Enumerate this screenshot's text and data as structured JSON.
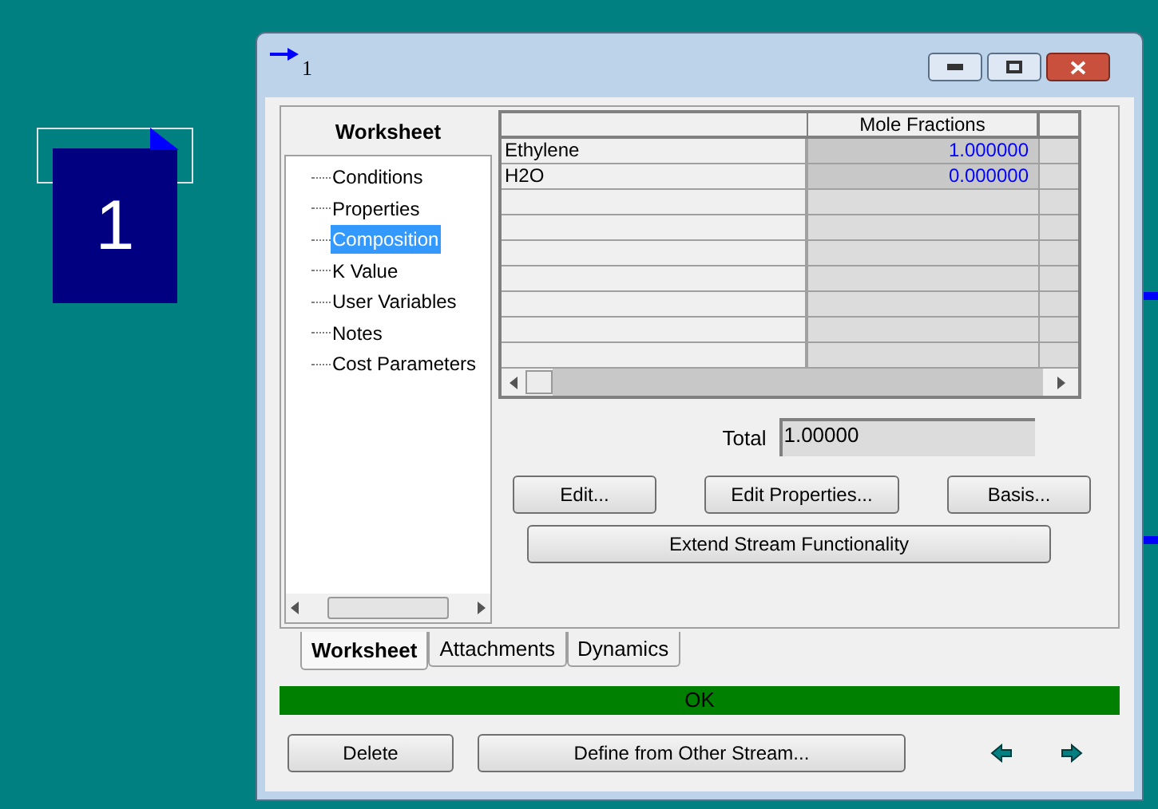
{
  "desktop": {
    "stream_label": "1"
  },
  "window": {
    "title": "1"
  },
  "tree": {
    "heading": "Worksheet",
    "items": [
      {
        "label": "Conditions",
        "selected": false
      },
      {
        "label": "Properties",
        "selected": false
      },
      {
        "label": "Composition",
        "selected": true
      },
      {
        "label": "K Value",
        "selected": false
      },
      {
        "label": "User Variables",
        "selected": false
      },
      {
        "label": "Notes",
        "selected": false
      },
      {
        "label": "Cost Parameters",
        "selected": false
      }
    ]
  },
  "grid": {
    "column_header": "Mole Fractions",
    "rows": [
      {
        "component": "Ethylene",
        "value": "1.000000"
      },
      {
        "component": "H2O",
        "value": "0.000000"
      }
    ]
  },
  "total": {
    "label": "Total",
    "value": "1.00000"
  },
  "buttons": [
    "Edit...",
    "Edit Properties...",
    "Basis..."
  ],
  "wide_button": "Extend Stream Functionality",
  "tabs": [
    {
      "label": "Worksheet",
      "selected": true
    },
    {
      "label": "Attachments",
      "selected": false
    },
    {
      "label": "Dynamics",
      "selected": false
    }
  ],
  "status": {
    "text": "OK",
    "color": "#008000"
  },
  "bottom_buttons": [
    "Delete",
    "Define from Other Stream..."
  ]
}
